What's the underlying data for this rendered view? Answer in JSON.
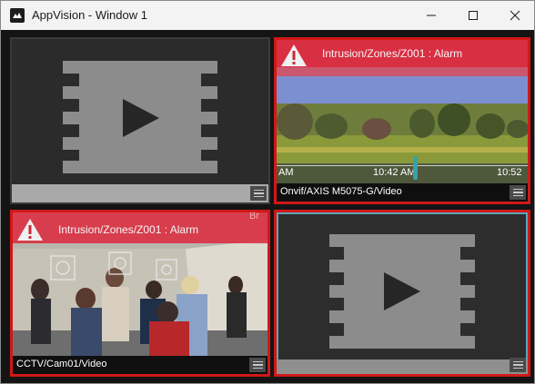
{
  "window": {
    "title": "AppVision - Window 1",
    "icons": [
      "app-logo-icon",
      "minimize-icon",
      "maximize-icon",
      "close-icon"
    ]
  },
  "colors": {
    "alarm_border": "#d01818",
    "alarm_band": "#dc283c",
    "selected_border": "#5aa6b8",
    "background": "#141414"
  },
  "panes": [
    {
      "id": 1,
      "state": "empty",
      "icon": "video-placeholder-icon",
      "label": ""
    },
    {
      "id": 2,
      "state": "playing",
      "alarm": "Intrusion/Zones/Z001 : Alarm",
      "label": "Onvif/AXIS M5075-G/Video",
      "timeline": {
        "left_label": "AM",
        "center_label": "10:42 AM",
        "right_label": "10:52"
      }
    },
    {
      "id": 3,
      "state": "playing",
      "alarm": "Intrusion/Zones/Z001 : Alarm",
      "corner_text": "Br",
      "label": "CCTV/Cam01/Video"
    },
    {
      "id": 4,
      "state": "empty",
      "icon": "video-placeholder-icon",
      "label": "",
      "selected": true
    }
  ]
}
